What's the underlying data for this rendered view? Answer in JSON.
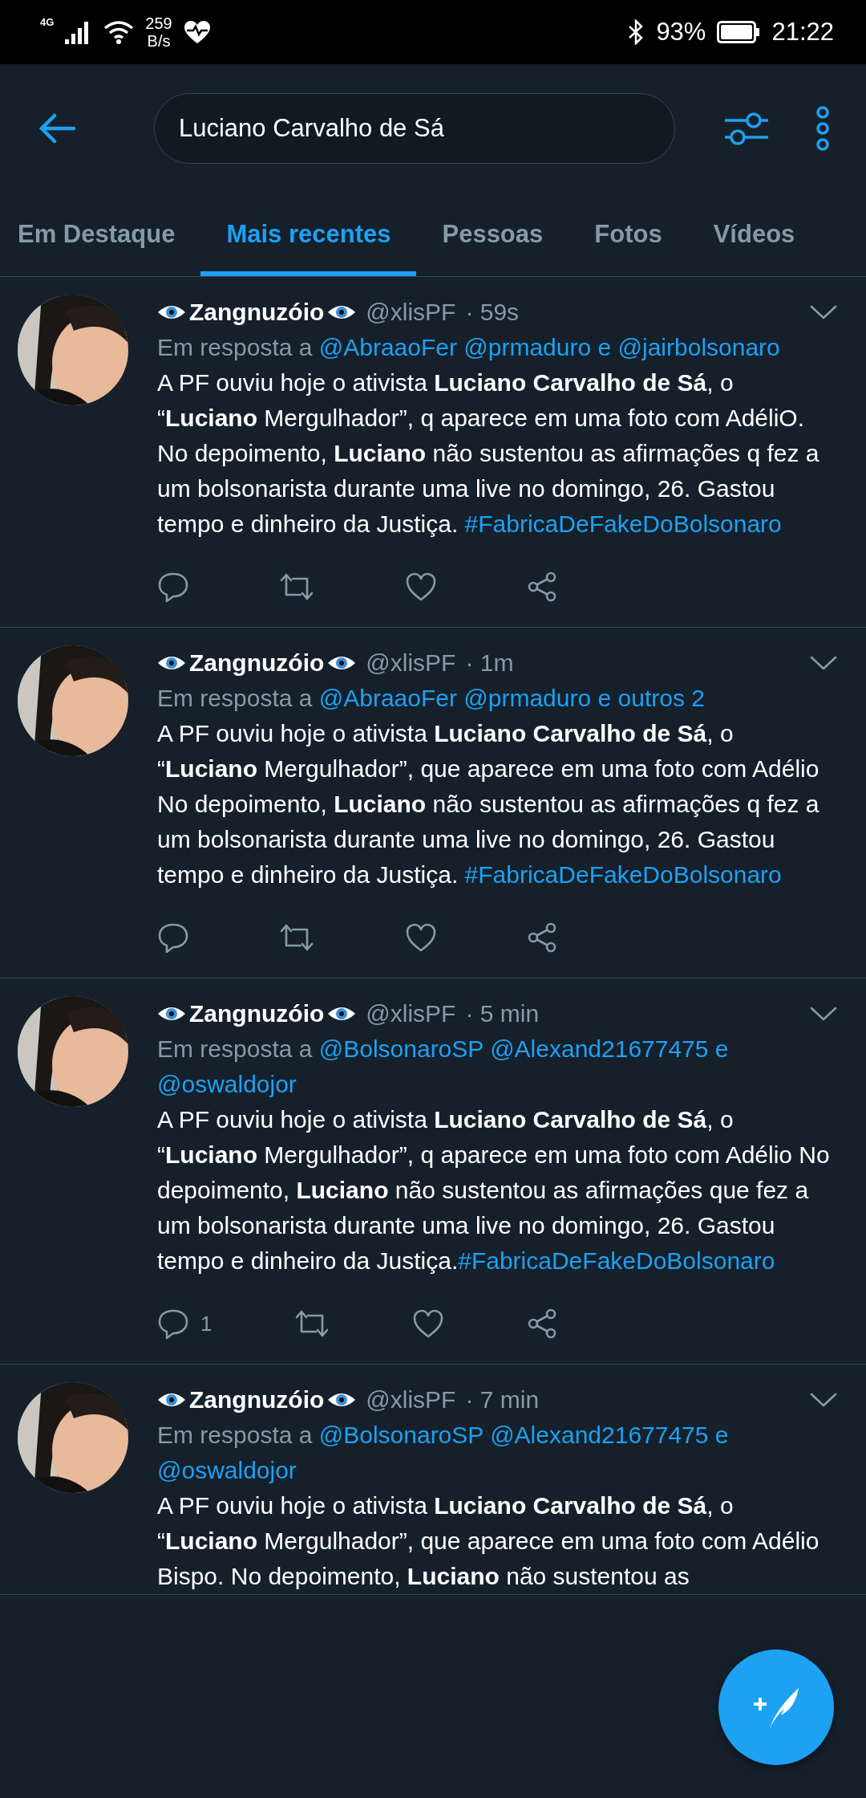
{
  "status_bar": {
    "network": "4G",
    "speed_value": "259",
    "speed_unit": "B/s",
    "battery": "93%",
    "time": "21:22"
  },
  "search": {
    "value": "Luciano Carvalho de Sá"
  },
  "tabs": [
    {
      "label": "Em Destaque",
      "selected": false
    },
    {
      "label": "Mais recentes",
      "selected": true
    },
    {
      "label": "Pessoas",
      "selected": false
    },
    {
      "label": "Fotos",
      "selected": false
    },
    {
      "label": "Vídeos",
      "selected": false
    }
  ],
  "tweets": [
    {
      "name": "Zangnuzóio",
      "handle": "@xlisPF",
      "time": "· 59s",
      "reply_prefix": "Em resposta a",
      "mentions": [
        "@AbraaoFer",
        "@prmaduro"
      ],
      "and_text": "e",
      "last_mention": "@jairbolsonaro",
      "body": "A PF ouviu hoje o ativista **Luciano Carvalho de Sá**, o “**Luciano** Mergulhador”, q aparece em uma foto com AdéliO. No depoimento, **Luciano** não sustentou as afirmações q fez a um bolsonarista durante uma live no domingo, 26. Gastou tempo e dinheiro da Justiça.",
      "hashtag": "#FabricaDeFakeDoBolsonaro",
      "hashtag_spaced": true
    },
    {
      "name": "Zangnuzóio",
      "handle": "@xlisPF",
      "time": "· 1m",
      "reply_prefix": "Em resposta a",
      "mentions": [
        "@AbraaoFer",
        "@prmaduro"
      ],
      "and_text": "e outros 2",
      "body": "A PF ouviu hoje o ativista **Luciano Carvalho de Sá**, o “**Luciano** Mergulhador”, que aparece em uma foto com Adélio No depoimento, **Luciano** não sustentou as afirmações q fez a um bolsonarista durante uma live no domingo, 26. Gastou tempo e dinheiro da Justiça.",
      "hashtag": "#FabricaDeFakeDoBolsonaro",
      "hashtag_spaced": true
    },
    {
      "name": "Zangnuzóio",
      "handle": "@xlisPF",
      "time": "· 5 min",
      "reply_prefix": "Em resposta a",
      "mentions": [
        "@BolsonaroSP",
        "@Alexand21677475"
      ],
      "and_text": "e",
      "last_mention": "@oswaldojor",
      "body": "A PF ouviu hoje o ativista **Luciano Carvalho de Sá**, o “**Luciano** Mergulhador”, q aparece em uma foto com Adélio No depoimento, **Luciano** não sustentou as afirmações que fez a um bolsonarista durante uma live no domingo, 26. Gastou tempo e dinheiro da Justiça.",
      "hashtag": "#FabricaDeFakeDoBolsonaro",
      "hashtag_spaced": false,
      "reply_count": "1"
    },
    {
      "name": "Zangnuzóio",
      "handle": "@xlisPF",
      "time": "· 7 min",
      "reply_prefix": "Em resposta a",
      "mentions": [
        "@BolsonaroSP",
        "@Alexand21677475"
      ],
      "and_text": "e",
      "last_mention": "@oswaldojor",
      "body": "A PF ouviu hoje o ativista **Luciano Carvalho de Sá**, o “**Luciano** Mergulhador”, que aparece em uma foto com Adélio Bispo. No depoimento, **Luciano** não sustentou as"
    }
  ]
}
